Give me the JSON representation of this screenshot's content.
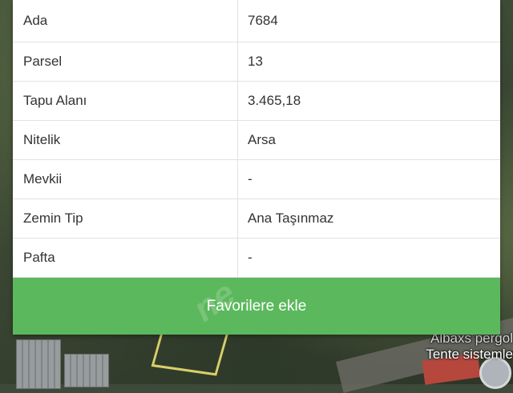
{
  "details": {
    "rows": [
      {
        "key": "Ada",
        "value": "7684"
      },
      {
        "key": "Parsel",
        "value": "13"
      },
      {
        "key": "Tapu Alanı",
        "value": "3.465,18"
      },
      {
        "key": "Nitelik",
        "value": "Arsa"
      },
      {
        "key": "Mevkii",
        "value": "-"
      },
      {
        "key": "Zemin Tip",
        "value": "Ana Taşınmaz"
      },
      {
        "key": "Pafta",
        "value": "-"
      }
    ]
  },
  "actions": {
    "favorite_label": "Favorilere ekle",
    "favorite_color": "#5cb85c"
  },
  "map": {
    "poi_label_line1": "Albaxs pergol",
    "poi_label_line2": "Tente sistemle"
  },
  "watermark": {
    "text": "ne"
  }
}
